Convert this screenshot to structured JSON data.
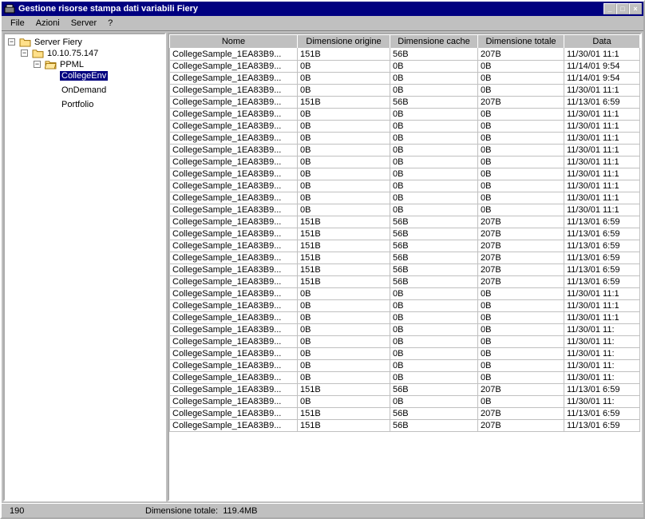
{
  "window": {
    "title": "Gestione risorse stampa dati variabili Fiery"
  },
  "menubar": {
    "file": "File",
    "azioni": "Azioni",
    "server": "Server",
    "help": "?"
  },
  "winbuttons": {
    "min": "_",
    "max": "□",
    "close": "×"
  },
  "tree": {
    "root": "Server  Fiery",
    "ip": "10.10.75.147",
    "ppml": "PPML",
    "item1": "CollegeEnv",
    "item2": "OnDemand",
    "item3": "Portfolio",
    "minus": "−"
  },
  "columns": {
    "nome": "Nome",
    "dimOrigine": "Dimensione origine",
    "dimCache": "Dimensione cache",
    "dimTotale": "Dimensione totale",
    "data": "Data"
  },
  "rows": [
    {
      "n": "CollegeSample_1EA83B9...",
      "o": "151B",
      "c": "56B",
      "t": "207B",
      "d": "11/30/01 11:1"
    },
    {
      "n": "CollegeSample_1EA83B9...",
      "o": "0B",
      "c": "0B",
      "t": "0B",
      "d": "11/14/01 9:54"
    },
    {
      "n": "CollegeSample_1EA83B9...",
      "o": "0B",
      "c": "0B",
      "t": "0B",
      "d": "11/14/01 9:54"
    },
    {
      "n": "CollegeSample_1EA83B9...",
      "o": "0B",
      "c": "0B",
      "t": "0B",
      "d": "11/30/01 11:1"
    },
    {
      "n": "CollegeSample_1EA83B9...",
      "o": "151B",
      "c": "56B",
      "t": "207B",
      "d": "11/13/01 6:59"
    },
    {
      "n": "CollegeSample_1EA83B9...",
      "o": "0B",
      "c": "0B",
      "t": "0B",
      "d": "11/30/01 11:1"
    },
    {
      "n": "CollegeSample_1EA83B9...",
      "o": "0B",
      "c": "0B",
      "t": "0B",
      "d": "11/30/01 11:1"
    },
    {
      "n": "CollegeSample_1EA83B9...",
      "o": "0B",
      "c": "0B",
      "t": "0B",
      "d": "11/30/01 11:1"
    },
    {
      "n": "CollegeSample_1EA83B9...",
      "o": "0B",
      "c": "0B",
      "t": "0B",
      "d": "11/30/01 11:1"
    },
    {
      "n": "CollegeSample_1EA83B9...",
      "o": "0B",
      "c": "0B",
      "t": "0B",
      "d": "11/30/01 11:1"
    },
    {
      "n": "CollegeSample_1EA83B9...",
      "o": "0B",
      "c": "0B",
      "t": "0B",
      "d": "11/30/01 11:1"
    },
    {
      "n": "CollegeSample_1EA83B9...",
      "o": "0B",
      "c": "0B",
      "t": "0B",
      "d": "11/30/01 11:1"
    },
    {
      "n": "CollegeSample_1EA83B9...",
      "o": "0B",
      "c": "0B",
      "t": "0B",
      "d": "11/30/01 11:1"
    },
    {
      "n": "CollegeSample_1EA83B9...",
      "o": "0B",
      "c": "0B",
      "t": "0B",
      "d": "11/30/01 11:1"
    },
    {
      "n": "CollegeSample_1EA83B9...",
      "o": "151B",
      "c": "56B",
      "t": "207B",
      "d": "11/13/01 6:59"
    },
    {
      "n": "CollegeSample_1EA83B9...",
      "o": "151B",
      "c": "56B",
      "t": "207B",
      "d": "11/13/01 6:59"
    },
    {
      "n": "CollegeSample_1EA83B9...",
      "o": "151B",
      "c": "56B",
      "t": "207B",
      "d": "11/13/01 6:59"
    },
    {
      "n": "CollegeSample_1EA83B9...",
      "o": "151B",
      "c": "56B",
      "t": "207B",
      "d": "11/13/01 6:59"
    },
    {
      "n": "CollegeSample_1EA83B9...",
      "o": "151B",
      "c": "56B",
      "t": "207B",
      "d": "11/13/01 6:59"
    },
    {
      "n": "CollegeSample_1EA83B9...",
      "o": "151B",
      "c": "56B",
      "t": "207B",
      "d": "11/13/01 6:59"
    },
    {
      "n": "CollegeSample_1EA83B9...",
      "o": "0B",
      "c": "0B",
      "t": "0B",
      "d": "11/30/01 11:1"
    },
    {
      "n": "CollegeSample_1EA83B9...",
      "o": "0B",
      "c": "0B",
      "t": "0B",
      "d": "11/30/01 11:1"
    },
    {
      "n": "CollegeSample_1EA83B9...",
      "o": "0B",
      "c": "0B",
      "t": "0B",
      "d": "11/30/01 11:1"
    },
    {
      "n": "CollegeSample_1EA83B9...",
      "o": "0B",
      "c": "0B",
      "t": "0B",
      "d": "11/30/01 11:"
    },
    {
      "n": "CollegeSample_1EA83B9...",
      "o": "0B",
      "c": "0B",
      "t": "0B",
      "d": "11/30/01 11:"
    },
    {
      "n": "CollegeSample_1EA83B9...",
      "o": "0B",
      "c": "0B",
      "t": "0B",
      "d": "11/30/01 11:"
    },
    {
      "n": "CollegeSample_1EA83B9...",
      "o": "0B",
      "c": "0B",
      "t": "0B",
      "d": "11/30/01 11:"
    },
    {
      "n": "CollegeSample_1EA83B9...",
      "o": "0B",
      "c": "0B",
      "t": "0B",
      "d": "11/30/01 11:"
    },
    {
      "n": "CollegeSample_1EA83B9...",
      "o": "151B",
      "c": "56B",
      "t": "207B",
      "d": "11/13/01 6:59"
    },
    {
      "n": "CollegeSample_1EA83B9...",
      "o": "0B",
      "c": "0B",
      "t": "0B",
      "d": "11/30/01 11:"
    },
    {
      "n": "CollegeSample_1EA83B9...",
      "o": "151B",
      "c": "56B",
      "t": "207B",
      "d": "11/13/01 6:59"
    },
    {
      "n": "CollegeSample_1EA83B9...",
      "o": "151B",
      "c": "56B",
      "t": "207B",
      "d": "11/13/01 6:59"
    }
  ],
  "statusbar": {
    "count": "190",
    "totalLabel": "Dimensione totale:",
    "totalValue": "119.4MB"
  }
}
